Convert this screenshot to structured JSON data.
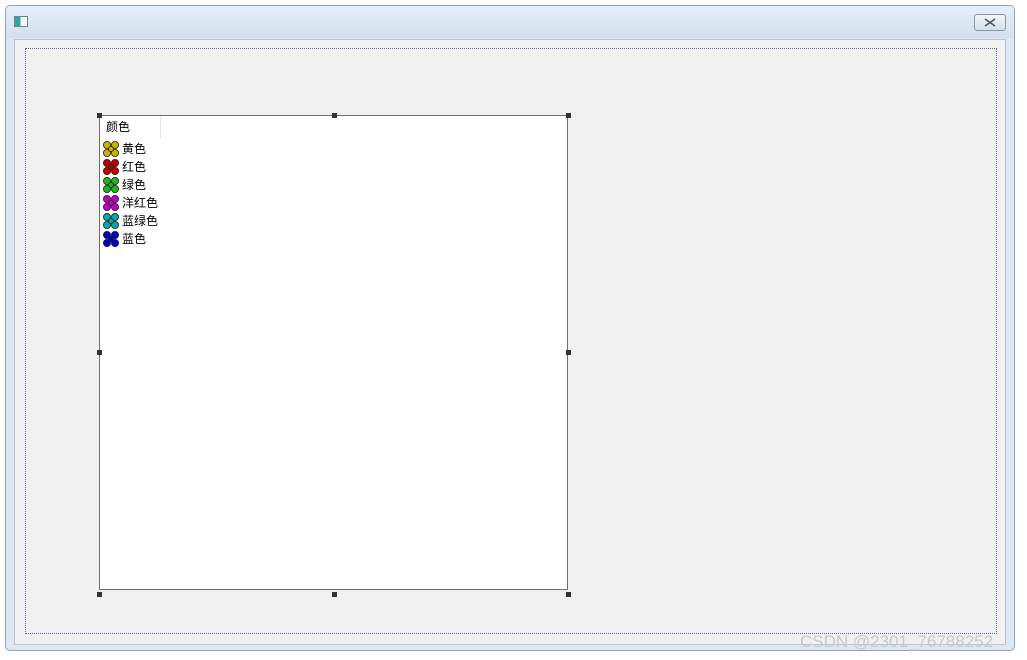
{
  "window": {
    "title": "",
    "icon": "app-window-icon",
    "close_icon": "close-icon"
  },
  "listview": {
    "column_header": "颜色",
    "items": [
      {
        "label": "黄色",
        "icon": "flower-icon",
        "color": "#c8b400"
      },
      {
        "label": "红色",
        "icon": "flower-icon",
        "color": "#c00000"
      },
      {
        "label": "绿色",
        "icon": "flower-icon",
        "color": "#1eb41e"
      },
      {
        "label": "洋红色",
        "icon": "flower-icon",
        "color": "#c000c0"
      },
      {
        "label": "蓝绿色",
        "icon": "flower-icon",
        "color": "#00a8a8"
      },
      {
        "label": "蓝色",
        "icon": "flower-icon",
        "color": "#0000c8"
      }
    ]
  },
  "watermark": "CSDN @2301_76788252"
}
